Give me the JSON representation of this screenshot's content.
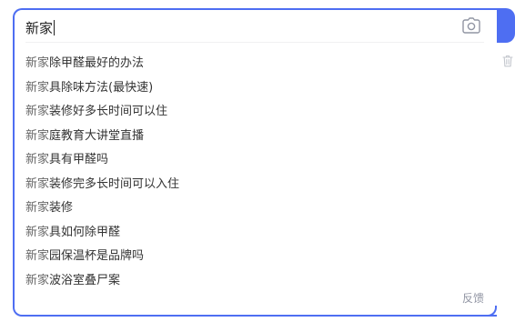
{
  "search": {
    "query": "新家",
    "camera_icon": "camera-icon"
  },
  "suggestions": [
    {
      "prefix": "新家",
      "rest": "除甲醛最好的办法"
    },
    {
      "prefix": "新家",
      "rest": "具除味方法(最快速)"
    },
    {
      "prefix": "新家",
      "rest": "装修好多长时间可以住"
    },
    {
      "prefix": "新家",
      "rest": "庭教育大讲堂直播"
    },
    {
      "prefix": "新家",
      "rest": "具有甲醛吗"
    },
    {
      "prefix": "新家",
      "rest": "装修完多长时间可以入住"
    },
    {
      "prefix": "新家",
      "rest": "装修"
    },
    {
      "prefix": "新家",
      "rest": "具如何除甲醛"
    },
    {
      "prefix": "新家",
      "rest": "园保温杯是品牌吗"
    },
    {
      "prefix": "新家",
      "rest": "波浴室叠尸案"
    }
  ],
  "footer": {
    "feedback_label": "反馈"
  },
  "colors": {
    "accent": "#4e6ef2",
    "prefix_text": "#666666",
    "suggestion_text": "#333333",
    "feedback_text": "#9195a3"
  },
  "icons": {
    "trash": "trash-icon"
  }
}
